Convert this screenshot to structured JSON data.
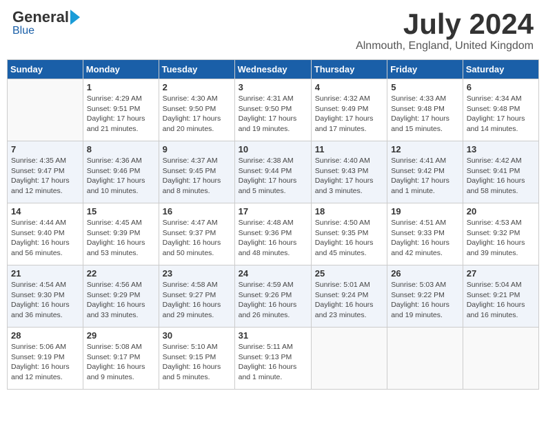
{
  "header": {
    "logo_general": "General",
    "logo_blue": "Blue",
    "title": "July 2024",
    "location": "Alnmouth, England, United Kingdom"
  },
  "days_of_week": [
    "Sunday",
    "Monday",
    "Tuesday",
    "Wednesday",
    "Thursday",
    "Friday",
    "Saturday"
  ],
  "weeks": [
    [
      {
        "day": "",
        "content": ""
      },
      {
        "day": "1",
        "content": "Sunrise: 4:29 AM\nSunset: 9:51 PM\nDaylight: 17 hours\nand 21 minutes."
      },
      {
        "day": "2",
        "content": "Sunrise: 4:30 AM\nSunset: 9:50 PM\nDaylight: 17 hours\nand 20 minutes."
      },
      {
        "day": "3",
        "content": "Sunrise: 4:31 AM\nSunset: 9:50 PM\nDaylight: 17 hours\nand 19 minutes."
      },
      {
        "day": "4",
        "content": "Sunrise: 4:32 AM\nSunset: 9:49 PM\nDaylight: 17 hours\nand 17 minutes."
      },
      {
        "day": "5",
        "content": "Sunrise: 4:33 AM\nSunset: 9:48 PM\nDaylight: 17 hours\nand 15 minutes."
      },
      {
        "day": "6",
        "content": "Sunrise: 4:34 AM\nSunset: 9:48 PM\nDaylight: 17 hours\nand 14 minutes."
      }
    ],
    [
      {
        "day": "7",
        "content": "Sunrise: 4:35 AM\nSunset: 9:47 PM\nDaylight: 17 hours\nand 12 minutes."
      },
      {
        "day": "8",
        "content": "Sunrise: 4:36 AM\nSunset: 9:46 PM\nDaylight: 17 hours\nand 10 minutes."
      },
      {
        "day": "9",
        "content": "Sunrise: 4:37 AM\nSunset: 9:45 PM\nDaylight: 17 hours\nand 8 minutes."
      },
      {
        "day": "10",
        "content": "Sunrise: 4:38 AM\nSunset: 9:44 PM\nDaylight: 17 hours\nand 5 minutes."
      },
      {
        "day": "11",
        "content": "Sunrise: 4:40 AM\nSunset: 9:43 PM\nDaylight: 17 hours\nand 3 minutes."
      },
      {
        "day": "12",
        "content": "Sunrise: 4:41 AM\nSunset: 9:42 PM\nDaylight: 17 hours\nand 1 minute."
      },
      {
        "day": "13",
        "content": "Sunrise: 4:42 AM\nSunset: 9:41 PM\nDaylight: 16 hours\nand 58 minutes."
      }
    ],
    [
      {
        "day": "14",
        "content": "Sunrise: 4:44 AM\nSunset: 9:40 PM\nDaylight: 16 hours\nand 56 minutes."
      },
      {
        "day": "15",
        "content": "Sunrise: 4:45 AM\nSunset: 9:39 PM\nDaylight: 16 hours\nand 53 minutes."
      },
      {
        "day": "16",
        "content": "Sunrise: 4:47 AM\nSunset: 9:37 PM\nDaylight: 16 hours\nand 50 minutes."
      },
      {
        "day": "17",
        "content": "Sunrise: 4:48 AM\nSunset: 9:36 PM\nDaylight: 16 hours\nand 48 minutes."
      },
      {
        "day": "18",
        "content": "Sunrise: 4:50 AM\nSunset: 9:35 PM\nDaylight: 16 hours\nand 45 minutes."
      },
      {
        "day": "19",
        "content": "Sunrise: 4:51 AM\nSunset: 9:33 PM\nDaylight: 16 hours\nand 42 minutes."
      },
      {
        "day": "20",
        "content": "Sunrise: 4:53 AM\nSunset: 9:32 PM\nDaylight: 16 hours\nand 39 minutes."
      }
    ],
    [
      {
        "day": "21",
        "content": "Sunrise: 4:54 AM\nSunset: 9:30 PM\nDaylight: 16 hours\nand 36 minutes."
      },
      {
        "day": "22",
        "content": "Sunrise: 4:56 AM\nSunset: 9:29 PM\nDaylight: 16 hours\nand 33 minutes."
      },
      {
        "day": "23",
        "content": "Sunrise: 4:58 AM\nSunset: 9:27 PM\nDaylight: 16 hours\nand 29 minutes."
      },
      {
        "day": "24",
        "content": "Sunrise: 4:59 AM\nSunset: 9:26 PM\nDaylight: 16 hours\nand 26 minutes."
      },
      {
        "day": "25",
        "content": "Sunrise: 5:01 AM\nSunset: 9:24 PM\nDaylight: 16 hours\nand 23 minutes."
      },
      {
        "day": "26",
        "content": "Sunrise: 5:03 AM\nSunset: 9:22 PM\nDaylight: 16 hours\nand 19 minutes."
      },
      {
        "day": "27",
        "content": "Sunrise: 5:04 AM\nSunset: 9:21 PM\nDaylight: 16 hours\nand 16 minutes."
      }
    ],
    [
      {
        "day": "28",
        "content": "Sunrise: 5:06 AM\nSunset: 9:19 PM\nDaylight: 16 hours\nand 12 minutes."
      },
      {
        "day": "29",
        "content": "Sunrise: 5:08 AM\nSunset: 9:17 PM\nDaylight: 16 hours\nand 9 minutes."
      },
      {
        "day": "30",
        "content": "Sunrise: 5:10 AM\nSunset: 9:15 PM\nDaylight: 16 hours\nand 5 minutes."
      },
      {
        "day": "31",
        "content": "Sunrise: 5:11 AM\nSunset: 9:13 PM\nDaylight: 16 hours\nand 1 minute."
      },
      {
        "day": "",
        "content": ""
      },
      {
        "day": "",
        "content": ""
      },
      {
        "day": "",
        "content": ""
      }
    ]
  ]
}
